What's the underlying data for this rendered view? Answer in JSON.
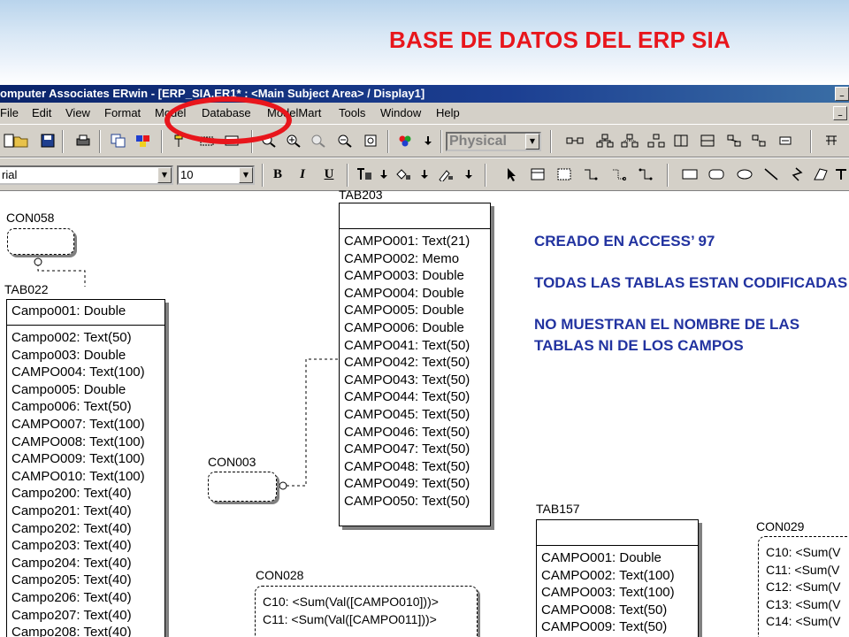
{
  "slide": {
    "title": "BASE DE DATOS DEL ERP SIA",
    "notes": [
      "CREADO EN ACCESS’ 97",
      "TODAS LAS TABLAS ESTAN CODIFICADAS",
      "NO MUESTRAN EL NOMBRE DE LAS TABLAS NI DE LOS CAMPOS"
    ]
  },
  "app": {
    "title": "omputer Associates ERwin - [ERP_SIA.ER1* : <Main Subject Area> / Display1]",
    "menu": [
      "File",
      "Edit",
      "View",
      "Format",
      "Model",
      "Database",
      "ModelMart",
      "Tools",
      "Window",
      "Help"
    ],
    "toolbar": {
      "view_mode": "Physical",
      "font_name": "rial",
      "font_size": "10",
      "bold": "B",
      "italic": "I",
      "underline": "U"
    }
  },
  "diagram": {
    "views": [
      {
        "name": "CON058",
        "attrs": []
      },
      {
        "name": "CON003",
        "attrs": []
      },
      {
        "name": "CON028",
        "attrs": [
          "C10: <Sum(Val([CAMPO010]))>",
          "C11: <Sum(Val([CAMPO011]))>"
        ]
      },
      {
        "name": "CON029",
        "attrs": [
          "C10: <Sum(V",
          "C11: <Sum(V",
          "C12: <Sum(V",
          "C13: <Sum(V",
          "C14: <Sum(V"
        ]
      }
    ],
    "tables": [
      {
        "name": "TAB022",
        "key": "Campo001: Double",
        "attrs": [
          "Campo002: Text(50)",
          "Campo003: Double",
          "CAMPO004: Text(100)",
          "Campo005: Double",
          "Campo006: Text(50)",
          "CAMPO007: Text(100)",
          "CAMPO008: Text(100)",
          "CAMPO009: Text(100)",
          "CAMPO010: Text(100)",
          "Campo200: Text(40)",
          "Campo201: Text(40)",
          "Campo202: Text(40)",
          "Campo203: Text(40)",
          "Campo204: Text(40)",
          "Campo205: Text(40)",
          "Campo206: Text(40)",
          "Campo207: Text(40)",
          "Campo208: Text(40)"
        ]
      },
      {
        "name": "TAB203",
        "key": "",
        "attrs": [
          "CAMPO001: Text(21)",
          "CAMPO002: Memo",
          "CAMPO003: Double",
          "CAMPO004: Double",
          "CAMPO005: Double",
          "CAMPO006: Double",
          "CAMPO041: Text(50)",
          "CAMPO042: Text(50)",
          "CAMPO043: Text(50)",
          "CAMPO044: Text(50)",
          "CAMPO045: Text(50)",
          "CAMPO046: Text(50)",
          "CAMPO047: Text(50)",
          "CAMPO048: Text(50)",
          "CAMPO049: Text(50)",
          "CAMPO050: Text(50)"
        ]
      },
      {
        "name": "TAB157",
        "key": "",
        "attrs": [
          "CAMPO001: Double",
          "CAMPO002: Text(100)",
          "CAMPO003: Text(100)",
          "CAMPO008: Text(50)",
          "CAMPO009: Text(50)"
        ]
      }
    ]
  },
  "colors": {
    "title_red": "#e8161c",
    "note_blue": "#2233a0",
    "window_face": "#d4d0c8"
  }
}
